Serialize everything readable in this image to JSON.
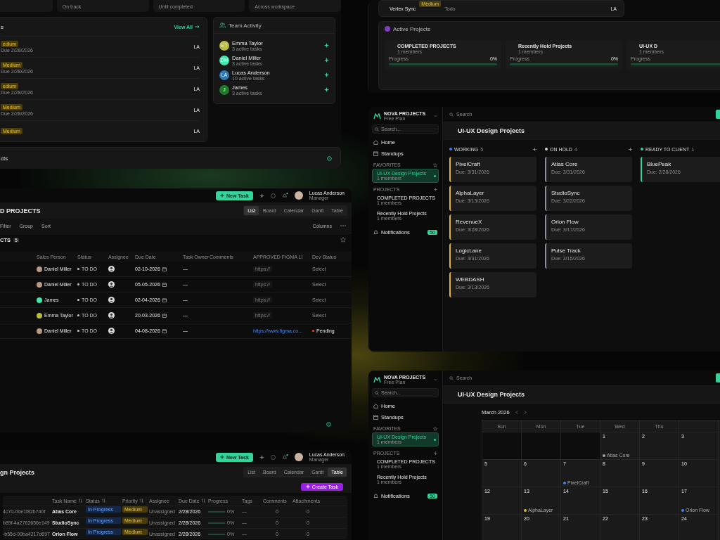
{
  "dashboard": {
    "stat_captions": [
      "On track",
      "Until completed",
      "Across workspace"
    ],
    "task_card": {
      "title": "s",
      "link": "View All",
      "rows": [
        {
          "priority": "edium",
          "due": "Due 2/28/2026",
          "assignee": "LA"
        },
        {
          "priority": "Medium",
          "due": "Due 2/28/2026",
          "assignee": "LA"
        },
        {
          "priority": "edium",
          "due": "Due 2/28/2026",
          "assignee": "LA"
        },
        {
          "priority": "Medium",
          "due": "Due 2/28/2026",
          "assignee": "LA"
        },
        {
          "priority": "Medium",
          "assignee": "LA"
        }
      ]
    },
    "team_activity": {
      "title": "Team Activity",
      "members": [
        {
          "initials": "ET",
          "name": "Emma Taylor",
          "tasks": "3 active tasks",
          "color": "#b9bd3a"
        },
        {
          "initials": "DM",
          "name": "Daniel Miller",
          "tasks": "3 active tasks",
          "color": "#3ee6b0"
        },
        {
          "initials": "LA",
          "name": "Lucas Anderson",
          "tasks": "10 active tasks",
          "color": "#2f78b8"
        },
        {
          "initials": "J",
          "name": "James",
          "tasks": "3 active tasks",
          "color": "#1f7a2a"
        }
      ]
    },
    "bottom_card": {
      "title": "cts"
    }
  },
  "overview": {
    "task_row": {
      "name": "Vertex Sync",
      "priority": "Medium",
      "status": "Todo",
      "assignee": "LA"
    },
    "active_projects": {
      "title": "Active Projects",
      "projects": [
        {
          "name": "COMPLETED PROJECTS",
          "members": "1 members",
          "progress_label": "Progress",
          "percent": "0%",
          "level": 0
        },
        {
          "name": "Recently Hold Projects",
          "members": "1 members",
          "progress_label": "Progress",
          "percent": "0%",
          "level": 0
        },
        {
          "name": "UI-UX D",
          "members": "1 members",
          "progress_label": "Progress",
          "level": 0
        }
      ]
    }
  },
  "list_window": {
    "top_bar": {
      "button": "New Task",
      "user": "Lucas Anderson",
      "role": "Manager"
    },
    "title": "D PROJECTS",
    "views": [
      {
        "label": "List",
        "selected": true
      },
      {
        "label": "Board",
        "selected": false
      },
      {
        "label": "Calendar",
        "selected": false
      },
      {
        "label": "Gantt",
        "selected": false
      },
      {
        "label": "Table",
        "selected": false
      }
    ],
    "toolbar": {
      "actions": [
        "Filter",
        "Group",
        "Sort"
      ],
      "columns": "Columns"
    },
    "group": {
      "title": "CTS",
      "count": "5"
    },
    "columns": [
      "Sales Person",
      "Status",
      "Assignee",
      "Due Date",
      "Task Owner",
      "Comments",
      "APPROVED FIGMA LI",
      "Dev Status"
    ],
    "rows": [
      {
        "person": "Daniel Miller",
        "color": "#b89a86",
        "status": "TO DO",
        "due": "02-10-2026",
        "owner": "—",
        "link": {
          "text": "https://",
          "filled": false
        },
        "dev": {
          "kind": "select",
          "text": "Select"
        }
      },
      {
        "person": "Daniel Miller",
        "color": "#b89a86",
        "status": "TO DO",
        "due": "05-05-2026",
        "owner": "—",
        "link": {
          "text": "https://",
          "filled": false
        },
        "dev": {
          "kind": "select",
          "text": "Select"
        }
      },
      {
        "person": "James",
        "color": "#3ee6b0",
        "status": "TO DO",
        "due": "02-04-2026",
        "owner": "—",
        "link": {
          "text": "https://",
          "filled": false
        },
        "dev": {
          "kind": "select",
          "text": "Select"
        }
      },
      {
        "person": "Emma Taylor",
        "color": "#b9bd3a",
        "status": "TO DO",
        "due": "20-03-2026",
        "owner": "—",
        "link": {
          "text": "https://",
          "filled": false
        },
        "dev": {
          "kind": "select",
          "text": "Select"
        }
      },
      {
        "person": "Daniel Miller",
        "color": "#b89a86",
        "status": "TO DO",
        "due": "04-08-2026",
        "owner": "—",
        "link": {
          "text": "https://www.figma.co...",
          "filled": true
        },
        "dev": {
          "kind": "status",
          "text": "Pending",
          "color": "#e5484d"
        }
      }
    ]
  },
  "table_window": {
    "top_bar": {
      "button": "New Task",
      "user": "Lucas Anderson",
      "role": "Manager"
    },
    "title": "gn Projects",
    "views": [
      {
        "label": "List",
        "selected": false
      },
      {
        "label": "Board",
        "selected": false
      },
      {
        "label": "Calendar",
        "selected": false
      },
      {
        "label": "Gantt",
        "selected": false
      },
      {
        "label": "Table",
        "selected": true
      }
    ],
    "create_button": "Create Task",
    "columns": [
      {
        "label": "Task Name",
        "sortable": true
      },
      {
        "label": "Status",
        "sortable": true
      },
      {
        "label": "Priority",
        "sortable": true
      },
      {
        "label": "Assignee",
        "sortable": false
      },
      {
        "label": "Due Date",
        "sortable": true
      },
      {
        "label": "Progress",
        "sortable": false
      },
      {
        "label": "Tags",
        "sortable": false
      },
      {
        "label": "Comments",
        "sortable": false
      },
      {
        "label": "Attachments",
        "sortable": false
      }
    ],
    "rows": [
      {
        "id": "4c7d-00e1f82b740f",
        "task": "Atlas Core",
        "status": "In Progress",
        "priority": "Medium",
        "assignee": "Unassigned",
        "due": "2/28/2026",
        "level": 0,
        "percent": "0%",
        "tags": "—",
        "comments": "0",
        "attachments": "0"
      },
      {
        "id": "b89f-4a2762656e149",
        "task": "StudioSync",
        "status": "In Progress",
        "priority": "Medium",
        "assignee": "Unassigned",
        "due": "2/28/2026",
        "level": 0,
        "percent": "0%",
        "tags": "—",
        "comments": "0",
        "attachments": "0"
      },
      {
        "id": "-b55d-99ba4217d697",
        "task": "Orion Flow",
        "status": "In Progress",
        "priority": "Medium",
        "assignee": "Unassigned",
        "due": "2/28/2026",
        "level": 0,
        "percent": "0%",
        "tags": "—",
        "comments": "0",
        "attachments": "0"
      }
    ]
  },
  "board_window": {
    "sidebar": {
      "brand": "NOVA PROJECTS",
      "plan": "Free Plan",
      "search": "Search...",
      "nav": [
        {
          "label": "Home",
          "kind": "home"
        },
        {
          "label": "Standups",
          "kind": "calendar"
        }
      ],
      "favorites_label": "FAVORITES",
      "favorites": [
        {
          "name": "UI-UX Design Projects",
          "members": "1 members",
          "selected": true
        }
      ],
      "projects_label": "PROJECTS",
      "projects": [
        {
          "name": "COMPLETED PROJECTS",
          "members": "1 members",
          "selected": false
        },
        {
          "name": "Recently Hold Projects",
          "members": "1 members",
          "selected": false
        }
      ],
      "notifications": "Notifications",
      "notification_count": "50"
    },
    "search": "Search",
    "title": "UI-UX Design Projects",
    "view": {
      "kind": "board",
      "columns": [
        {
          "name": "WORKING",
          "count": "5",
          "color": "#3b82f6",
          "cards": [
            {
              "name": "PixelCraft",
              "due": "Due: 3/31/2026",
              "color": "#e0b43a"
            },
            {
              "name": "AlphaLayer",
              "due": "Due: 3/13/2026",
              "color": "#e0b43a"
            },
            {
              "name": "RevenueX",
              "due": "Due: 3/28/2026",
              "color": "#e0b43a"
            },
            {
              "name": "LogicLane",
              "due": "Due: 3/31/2026",
              "color": "#e0b43a"
            },
            {
              "name": "WEBDASH",
              "due": "Due: 3/13/2026",
              "color": "#e0b43a"
            }
          ]
        },
        {
          "name": "ON HOLD",
          "count": "4",
          "color": "#d4d4d4",
          "cards": [
            {
              "name": "Atlas Core",
              "due": "Due: 3/31/2026",
              "color": "#8a9099"
            },
            {
              "name": "StudioSync",
              "due": "Due: 3/22/2026",
              "color": "#8a9099"
            },
            {
              "name": "Orion Flow",
              "due": "Due: 3/17/2026",
              "color": "#8a9099"
            },
            {
              "name": "Pulse Track",
              "due": "Due: 3/15/2026",
              "color": "#8a9099"
            }
          ]
        },
        {
          "name": "READY TO CLIENT",
          "count": "1",
          "color": "#34d399",
          "cards": [
            {
              "name": "BluePeak",
              "due": "Due: 2/28/2026",
              "color": "#34d399"
            }
          ]
        }
      ]
    }
  },
  "calendar_window": {
    "sidebar": {
      "brand": "NOVA PROJECTS",
      "plan": "Free Plan",
      "search": "Search...",
      "nav": [
        {
          "label": "Home",
          "kind": "home"
        },
        {
          "label": "Standups",
          "kind": "calendar"
        }
      ],
      "favorites_label": "FAVORITES",
      "favorites": [
        {
          "name": "UI-UX Design Projects",
          "members": "1 members",
          "selected": true
        }
      ],
      "projects_label": "PROJECTS",
      "projects": [
        {
          "name": "COMPLETED PROJECTS",
          "members": "1 members",
          "selected": false
        },
        {
          "name": "Recently Hold Projects",
          "members": "1 members",
          "selected": false
        }
      ],
      "notifications": "Notifications",
      "notification_count": "50"
    },
    "search": "Search",
    "title": "UI-UX Design Projects",
    "view": {
      "kind": "calendar",
      "month": "March 2026",
      "weekdays": [
        "Sun",
        "Mon",
        "Tue",
        "Wed",
        "Thu"
      ],
      "weeks": [
        [
          {
            "kind": "empty"
          },
          {
            "kind": "empty"
          },
          {
            "kind": "empty"
          },
          {
            "kind": "day",
            "day": "1",
            "events": [
              {
                "name": "Atlas Core",
                "color": "#9ca3af"
              }
            ]
          },
          {
            "kind": "day",
            "day": "2"
          },
          {
            "kind": "day",
            "day": "3"
          }
        ],
        [
          {
            "kind": "day",
            "day": "5"
          },
          {
            "kind": "day",
            "day": "6"
          },
          {
            "kind": "day",
            "day": "7",
            "events": [
              {
                "name": "PixelCraft",
                "color": "#3b82f6"
              }
            ]
          },
          {
            "kind": "day",
            "day": "8"
          },
          {
            "kind": "day",
            "day": "9"
          },
          {
            "kind": "day",
            "day": "10"
          }
        ],
        [
          {
            "kind": "day",
            "day": "12"
          },
          {
            "kind": "day",
            "day": "13",
            "events": [
              {
                "name": "AlphaLayer",
                "color": "#e0b43a"
              }
            ]
          },
          {
            "kind": "day",
            "day": "14"
          },
          {
            "kind": "day",
            "day": "15"
          },
          {
            "kind": "day",
            "day": "16"
          },
          {
            "kind": "day",
            "day": "17",
            "events": [
              {
                "name": "Orion Flow",
                "color": "#3b82f6"
              }
            ]
          }
        ],
        [
          {
            "kind": "day",
            "day": "19"
          },
          {
            "kind": "day",
            "day": "20"
          },
          {
            "kind": "day",
            "day": "21"
          },
          {
            "kind": "day",
            "day": "22"
          },
          {
            "kind": "day",
            "day": "23"
          },
          {
            "kind": "day",
            "day": "24"
          }
        ]
      ]
    }
  }
}
